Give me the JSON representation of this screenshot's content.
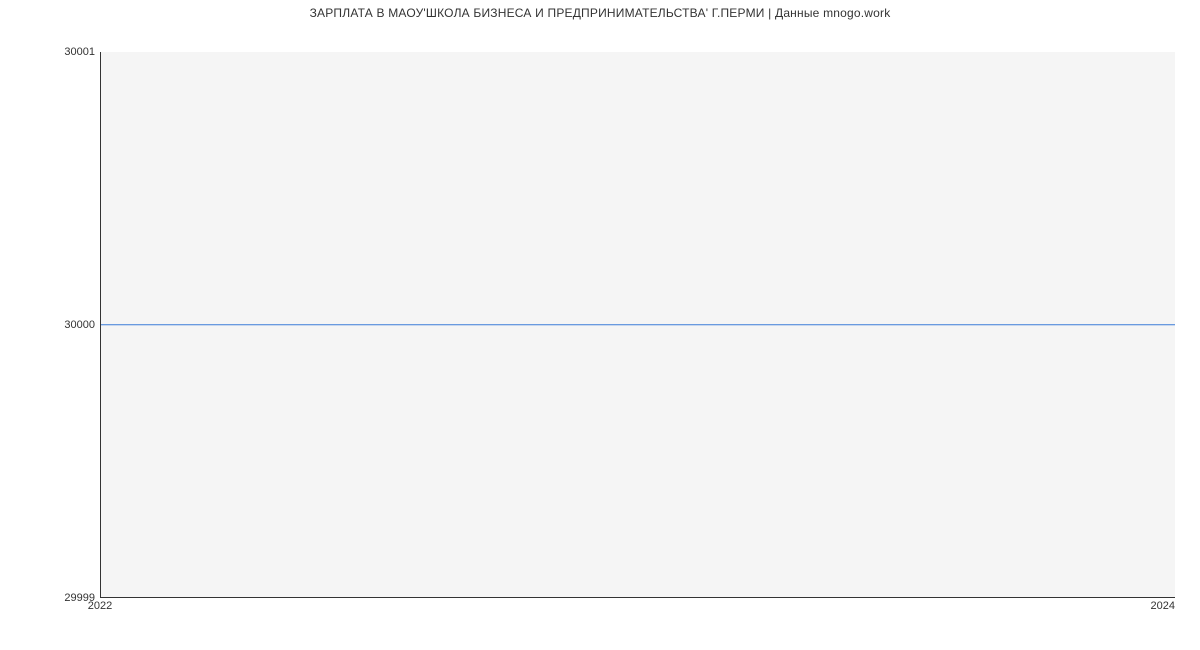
{
  "chart_data": {
    "type": "line",
    "title": "ЗАРПЛАТА В МАОУ'ШКОЛА БИЗНЕСА И ПРЕДПРИНИМАТЕЛЬСТВА' Г.ПЕРМИ | Данные mnogo.work",
    "x": [
      2022,
      2024
    ],
    "values": [
      30000,
      30000
    ],
    "xlabel": "",
    "ylabel": "",
    "xlim": [
      2022,
      2024
    ],
    "ylim": [
      29999,
      30001
    ],
    "x_ticks": [
      2022,
      2024
    ],
    "y_ticks": [
      29999,
      30000,
      30001
    ]
  },
  "y_tick_labels": {
    "0": "29999",
    "1": "30000",
    "2": "30001"
  },
  "x_tick_labels": {
    "0": "2022",
    "1": "2024"
  }
}
